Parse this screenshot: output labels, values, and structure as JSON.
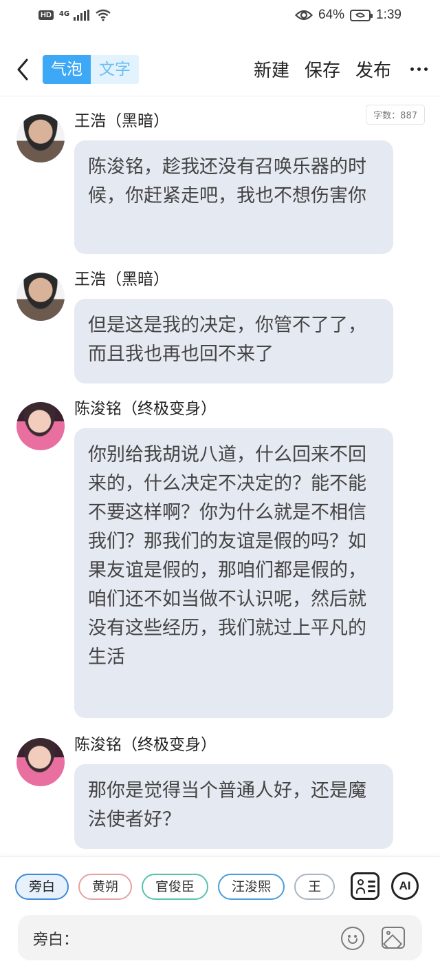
{
  "status_bar": {
    "hd": "HD",
    "network": "4G",
    "battery": "64%",
    "time": "1:39"
  },
  "header": {
    "tabs": [
      {
        "label": "气泡",
        "active": true
      },
      {
        "label": "文字",
        "active": false
      }
    ],
    "actions": [
      "新建",
      "保存",
      "发布"
    ]
  },
  "word_count": "字数：887",
  "messages": [
    {
      "sender": "王浩（黑暗）",
      "text": "陈浚铭，趁我还没有召唤乐器的时候，你赶紧走吧，我也不想伤害你"
    },
    {
      "sender": "王浩（黑暗）",
      "text": "但是这是我的决定，你管不了了，而且我也再也回不来了"
    },
    {
      "sender": "陈浚铭（终极变身）",
      "text": "你别给我胡说八道，什么回来不回来的，什么决定不决定的？能不能不要这样啊？你为什么就是不相信我们？那我们的友谊是假的吗？如果友谊是假的，那咱们都是假的，咱们还不如当做不认识呢，然后就没有这些经历，我们就过上平凡的生活"
    },
    {
      "sender": "陈浚铭（终极变身）",
      "text": "那你是觉得当个普通人好，还是魔法使者好？"
    }
  ],
  "bottom": {
    "chips": [
      "旁白",
      "黄朔",
      "官俊臣",
      "汪浚熙",
      "王"
    ],
    "ai_label": "AI",
    "input_label": "旁白："
  },
  "colors": {
    "accent": "#3da8f5",
    "bubble": "#e5e9f1"
  }
}
